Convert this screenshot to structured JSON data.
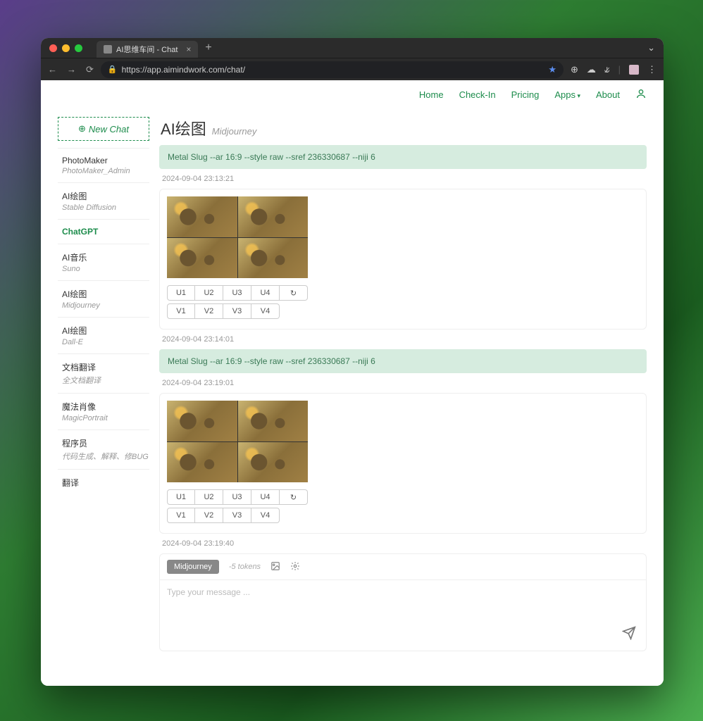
{
  "browser": {
    "tab_title": "AI思维车间 - Chat",
    "url": "https://app.aimindwork.com/chat/"
  },
  "nav": {
    "home": "Home",
    "checkin": "Check-In",
    "pricing": "Pricing",
    "apps": "Apps",
    "about": "About"
  },
  "sidebar": {
    "new_chat": "New Chat",
    "items": [
      {
        "title": "PhotoMaker",
        "sub": "PhotoMaker_Admin"
      },
      {
        "title": "AI绘图",
        "sub": "Stable Diffusion"
      },
      {
        "title": "ChatGPT",
        "sub": ""
      },
      {
        "title": "AI音乐",
        "sub": "Suno"
      },
      {
        "title": "AI绘图",
        "sub": "Midjourney"
      },
      {
        "title": "AI绘图",
        "sub": "Dall-E"
      },
      {
        "title": "文档翻译",
        "sub": "全文档翻译"
      },
      {
        "title": "魔法肖像",
        "sub": "MagicPortrait"
      },
      {
        "title": "程序员",
        "sub": "代码生成、解释、修BUG"
      },
      {
        "title": "翻译",
        "sub": ""
      }
    ]
  },
  "header": {
    "title": "AI绘图",
    "sub": "Midjourney"
  },
  "messages": [
    {
      "prompt": "Metal Slug --ar 16:9 --style raw --sref 236330687 --niji 6",
      "prompt_ts": "2024-09-04 23:13:21",
      "result_ts": "2024-09-04 23:14:01",
      "u": [
        "U1",
        "U2",
        "U3",
        "U4"
      ],
      "v": [
        "V1",
        "V2",
        "V3",
        "V4"
      ]
    },
    {
      "prompt": "Metal Slug --ar 16:9 --style raw --sref 236330687 --niji 6",
      "prompt_ts": "2024-09-04 23:19:01",
      "result_ts": "2024-09-04 23:19:40",
      "u": [
        "U1",
        "U2",
        "U3",
        "U4"
      ],
      "v": [
        "V1",
        "V2",
        "V3",
        "V4"
      ]
    }
  ],
  "composer": {
    "model": "Midjourney",
    "tokens": "-5 tokens",
    "placeholder": "Type your message ..."
  }
}
